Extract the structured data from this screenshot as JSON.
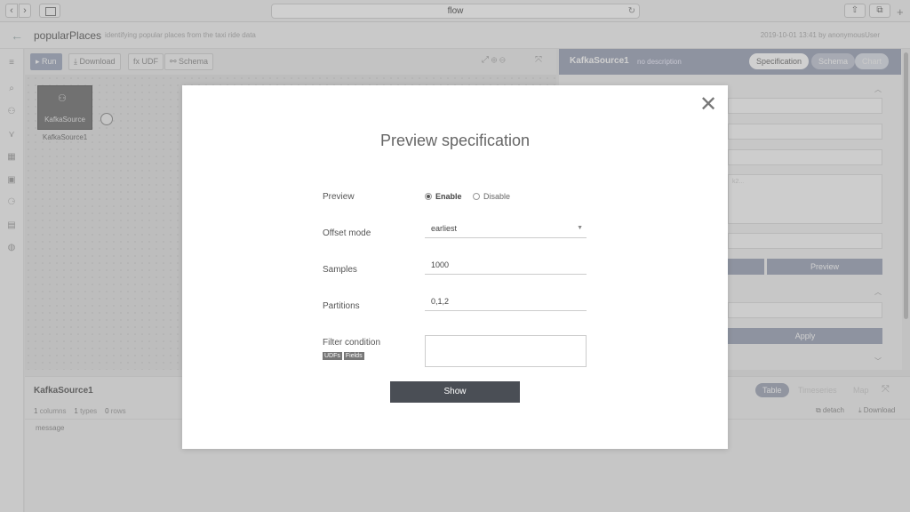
{
  "browser": {
    "url": "flow",
    "reload_icon": "reload-icon",
    "back_glyph": "‹",
    "forward_glyph": "›",
    "share_glyph": "⇧",
    "tabs_glyph": "⧉",
    "newtab_glyph": "+"
  },
  "app": {
    "title": "popularPlaces",
    "description": "identifying popular places from the taxi ride data",
    "meta": "2019-10-01 13:41 by anonymousUser",
    "back_glyph": "←"
  },
  "rail_icons": [
    "menu-icon",
    "search-icon",
    "source-icon",
    "filter-icon",
    "table-icon",
    "settings-icon",
    "pipeline-icon",
    "document-icon",
    "database-icon"
  ],
  "toolbar": {
    "run_label": "▸ Run",
    "download_label": "⤓ Download",
    "udf_label": "fx UDF",
    "schema_label": "⚯ Schema",
    "right_icons": "⤢ ⊕ ⊖",
    "expand_glyph": "⤧"
  },
  "node": {
    "icon": "kafka-icon",
    "icon_glyph": "⚇",
    "label": "KafkaSource",
    "caption": "KafkaSource1"
  },
  "right_panel": {
    "title": "KafkaSource1",
    "description": "no description",
    "tabs": {
      "specification": "Specification",
      "schema": "Schema",
      "chart": "Chart"
    },
    "preview_button": "Preview",
    "apply_button": "Apply",
    "field_hint": "k2..."
  },
  "bottom_panel": {
    "title": "KafkaSource1",
    "columns_count": "1",
    "columns_label": "columns",
    "types_count": "1",
    "types_label": "types",
    "rows_count": "0",
    "rows_label": "rows",
    "column_name": "message",
    "tabs": {
      "table": "Table",
      "timeseries": "Timeseries",
      "map": "Map"
    },
    "detach_label": "⧉ detach",
    "download_label": "⤓ Download",
    "expand_glyph": "⤧"
  },
  "modal": {
    "title": "Preview specification",
    "close_glyph": "✕",
    "preview": {
      "label": "Preview",
      "options": [
        "Enable",
        "Disable"
      ],
      "selected": "Enable"
    },
    "offset_mode": {
      "label": "Offset mode",
      "value": "earliest"
    },
    "samples": {
      "label": "Samples",
      "value": "1000"
    },
    "partitions": {
      "label": "Partitions",
      "value": "0,1,2"
    },
    "filter_condition": {
      "label": "Filter condition",
      "value": "",
      "tags": [
        "UDFs",
        "Fields"
      ]
    },
    "show_button": "Show"
  }
}
